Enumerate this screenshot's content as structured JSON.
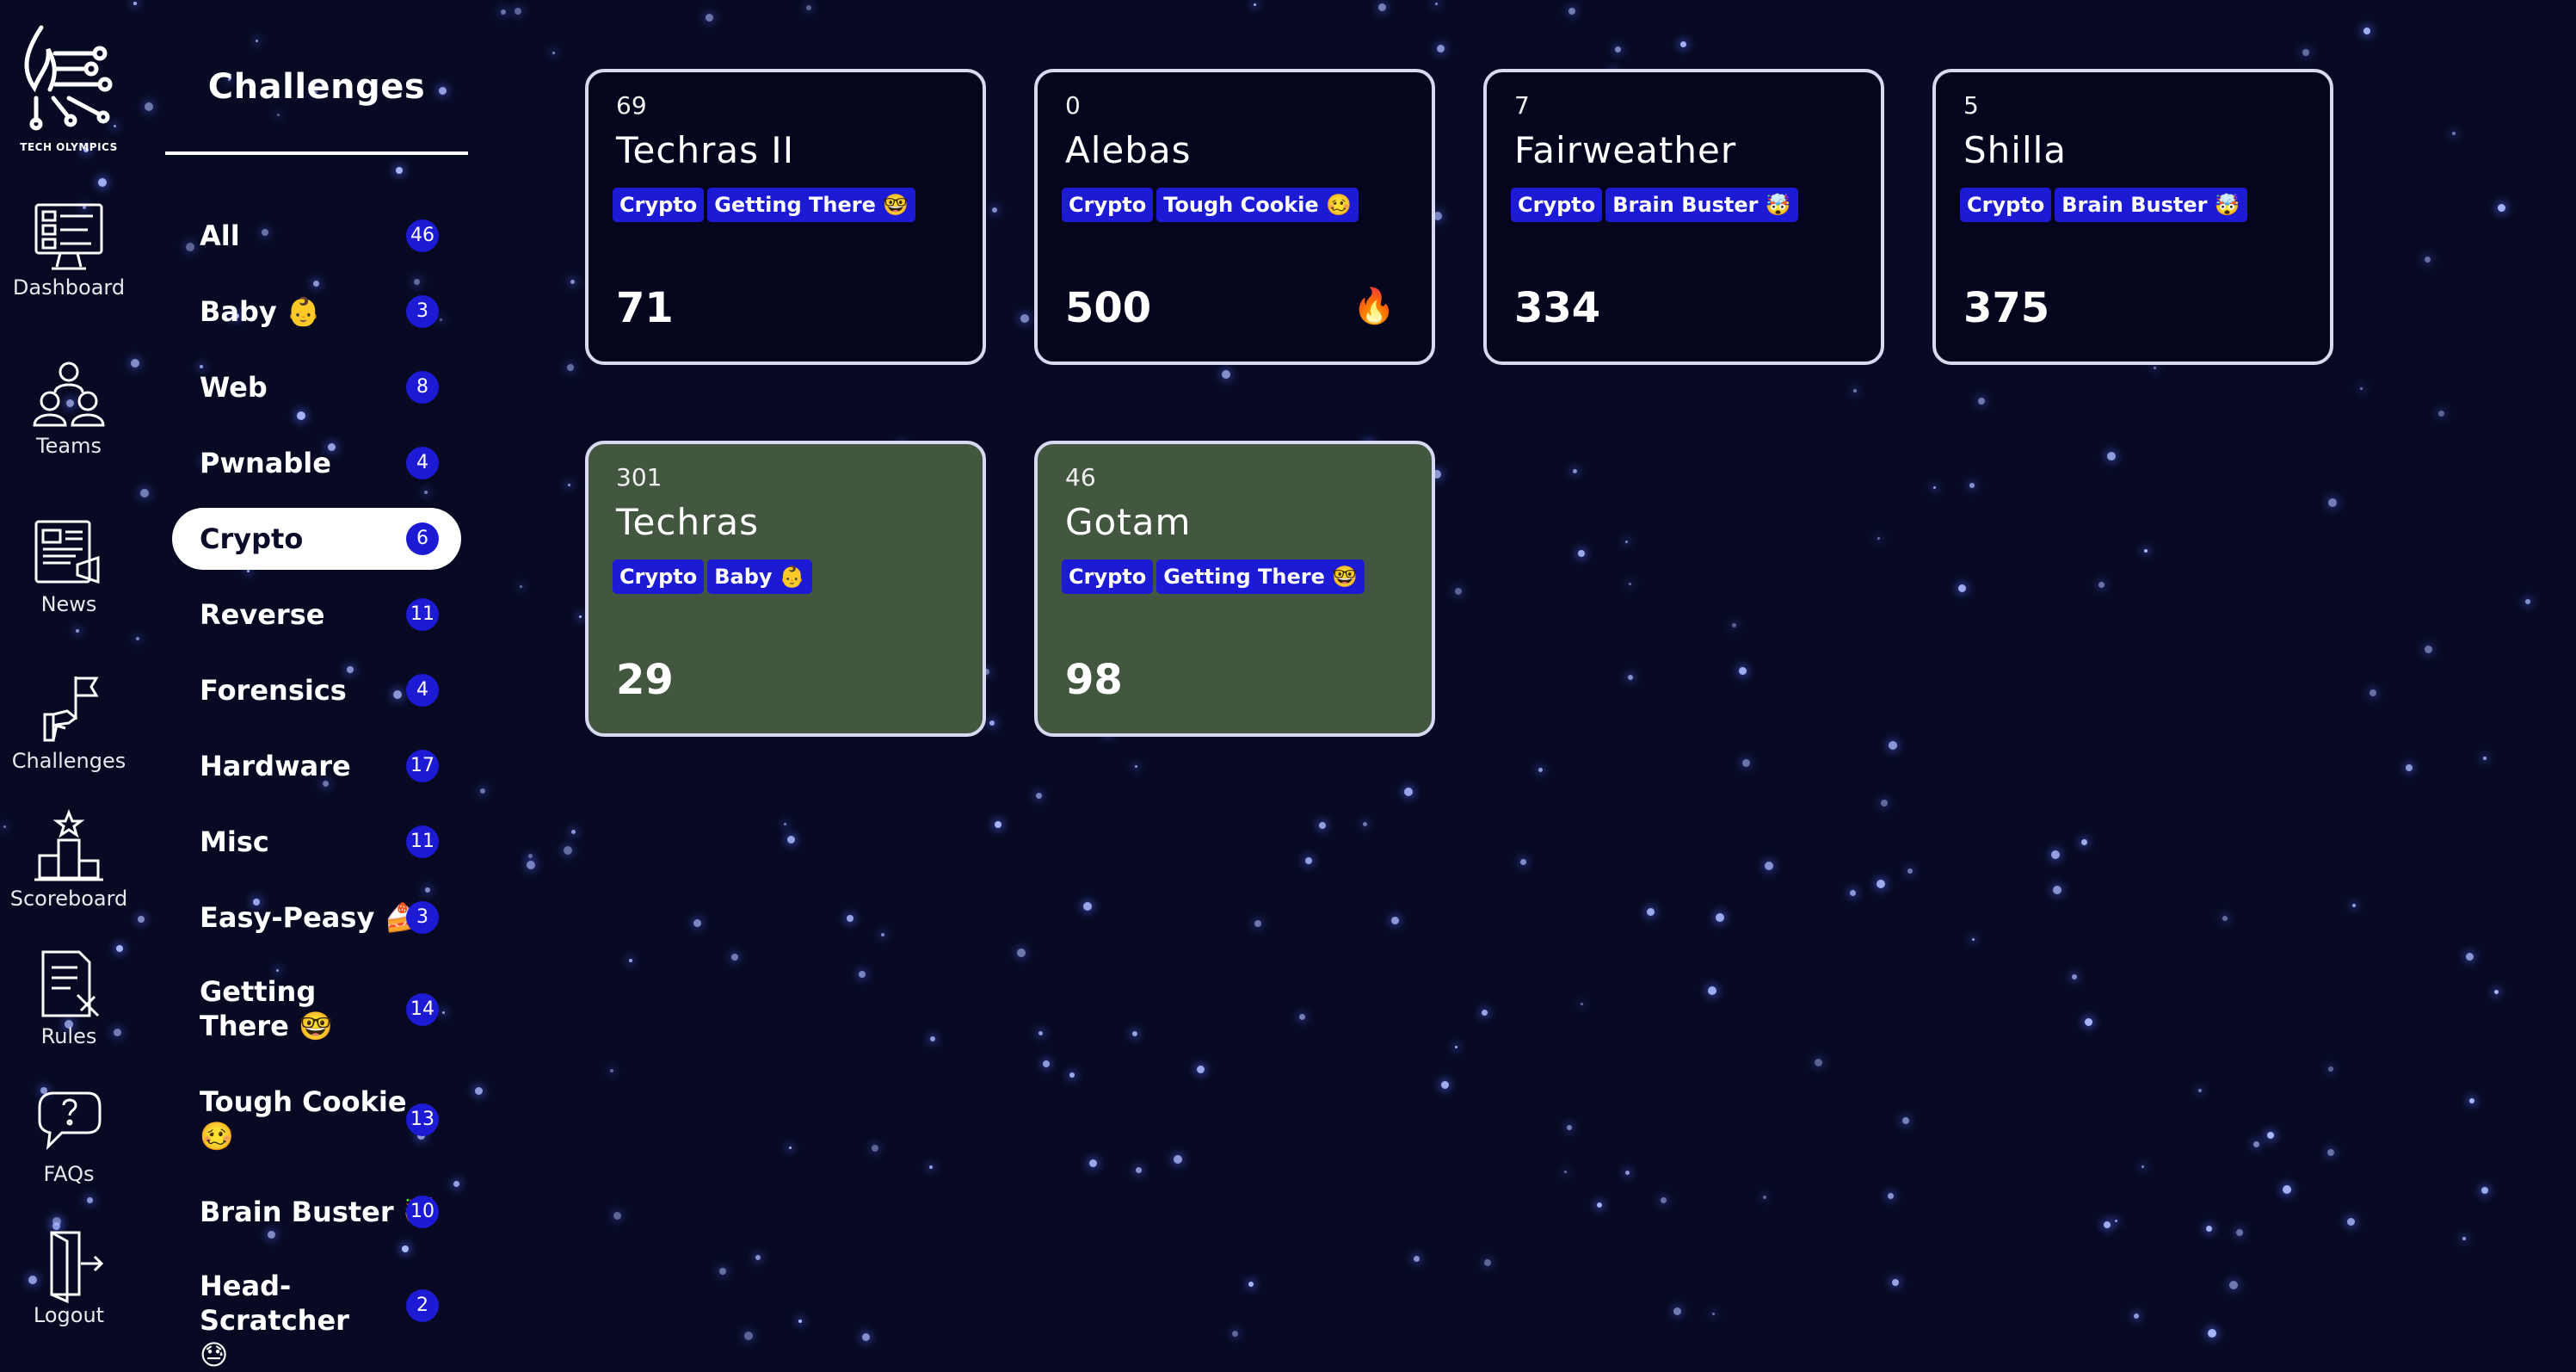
{
  "app": {
    "logo_text": "TECH OLYMPICS"
  },
  "nav": [
    {
      "label": "Dashboard",
      "icon": "dashboard-icon"
    },
    {
      "label": "Teams",
      "icon": "teams-icon"
    },
    {
      "label": "News",
      "icon": "news-icon"
    },
    {
      "label": "Challenges",
      "icon": "challenges-icon"
    },
    {
      "label": "Scoreboard",
      "icon": "scoreboard-icon"
    },
    {
      "label": "Rules",
      "icon": "rules-icon"
    },
    {
      "label": "FAQs",
      "icon": "faqs-icon"
    },
    {
      "label": "Logout",
      "icon": "logout-icon"
    }
  ],
  "sidebar": {
    "title": "Challenges",
    "categories": [
      {
        "label": "All",
        "count": "46"
      },
      {
        "label": "Baby 👶",
        "count": "3"
      },
      {
        "label": "Web",
        "count": "8"
      },
      {
        "label": "Pwnable",
        "count": "4"
      },
      {
        "label": "Crypto",
        "count": "6",
        "active": true
      },
      {
        "label": "Reverse",
        "count": "11"
      },
      {
        "label": "Forensics",
        "count": "4"
      },
      {
        "label": "Hardware",
        "count": "17"
      },
      {
        "label": "Misc",
        "count": "11"
      },
      {
        "label": "Easy-Peasy 🍰",
        "count": "3"
      },
      {
        "label": "Getting There 🤓",
        "count": "14"
      },
      {
        "label": "Tough Cookie 🥴",
        "count": "13"
      },
      {
        "label": "Brain Buster 🤯",
        "count": "10"
      },
      {
        "label": "Head-Scratcher 😓",
        "count": "2"
      }
    ]
  },
  "challenges": [
    {
      "solves": "69",
      "name": "Techras II",
      "tags": [
        "Crypto",
        "Getting There 🤓"
      ],
      "points": "71",
      "solved": false
    },
    {
      "solves": "0",
      "name": "Alebas",
      "tags": [
        "Crypto",
        "Tough Cookie 🥴"
      ],
      "points": "500",
      "solved": false,
      "badge": "🔥"
    },
    {
      "solves": "7",
      "name": "Fairweather",
      "tags": [
        "Crypto",
        "Brain Buster 🤯"
      ],
      "points": "334",
      "solved": false
    },
    {
      "solves": "5",
      "name": "Shilla",
      "tags": [
        "Crypto",
        "Brain Buster 🤯"
      ],
      "points": "375",
      "solved": false
    },
    {
      "solves": "301",
      "name": "Techras",
      "tags": [
        "Crypto",
        "Baby 👶"
      ],
      "points": "29",
      "solved": true
    },
    {
      "solves": "46",
      "name": "Gotam",
      "tags": [
        "Crypto",
        "Getting There 🤓"
      ],
      "points": "98",
      "solved": true
    }
  ],
  "colors": {
    "background": "#070a22",
    "accent": "#1d1ad6",
    "solved_card": "#435740",
    "card_border": "#d6d9f0"
  }
}
